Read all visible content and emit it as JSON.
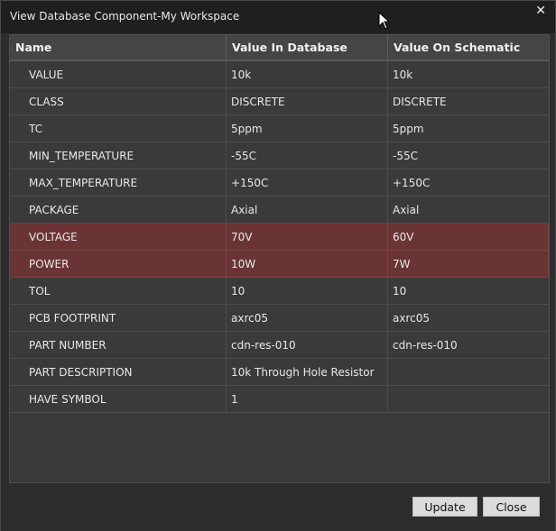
{
  "window": {
    "title": "View Database Component-My Workspace",
    "close_glyph": "✕"
  },
  "table": {
    "columns": [
      "Name",
      "Value In Database",
      "Value On Schematic"
    ],
    "rows": [
      {
        "name": "VALUE",
        "db": "10k",
        "sch": "10k",
        "mismatch": false
      },
      {
        "name": "CLASS",
        "db": "DISCRETE",
        "sch": "DISCRETE",
        "mismatch": false
      },
      {
        "name": "TC",
        "db": "5ppm",
        "sch": "5ppm",
        "mismatch": false
      },
      {
        "name": "MIN_TEMPERATURE",
        "db": "-55C",
        "sch": "-55C",
        "mismatch": false
      },
      {
        "name": "MAX_TEMPERATURE",
        "db": "+150C",
        "sch": "+150C",
        "mismatch": false
      },
      {
        "name": "PACKAGE",
        "db": "Axial",
        "sch": "Axial",
        "mismatch": false
      },
      {
        "name": "VOLTAGE",
        "db": "70V",
        "sch": "60V",
        "mismatch": true
      },
      {
        "name": "POWER",
        "db": "10W",
        "sch": "7W",
        "mismatch": true
      },
      {
        "name": "TOL",
        "db": "10",
        "sch": "10",
        "mismatch": false
      },
      {
        "name": "PCB FOOTPRINT",
        "db": "axrc05",
        "sch": "axrc05",
        "mismatch": false
      },
      {
        "name": "PART NUMBER",
        "db": "cdn-res-010",
        "sch": "cdn-res-010",
        "mismatch": false
      },
      {
        "name": "PART DESCRIPTION",
        "db": "10k Through Hole Resistor",
        "sch": "",
        "mismatch": false
      },
      {
        "name": "HAVE SYMBOL",
        "db": "1",
        "sch": "",
        "mismatch": false
      }
    ]
  },
  "buttons": {
    "update_label": "Update",
    "close_label": "Close"
  },
  "colors": {
    "mismatch_row": "#6b3434",
    "background": "#2d2d2d"
  },
  "icons": {
    "cursor": "mouse-pointer-icon",
    "close": "close-icon"
  }
}
